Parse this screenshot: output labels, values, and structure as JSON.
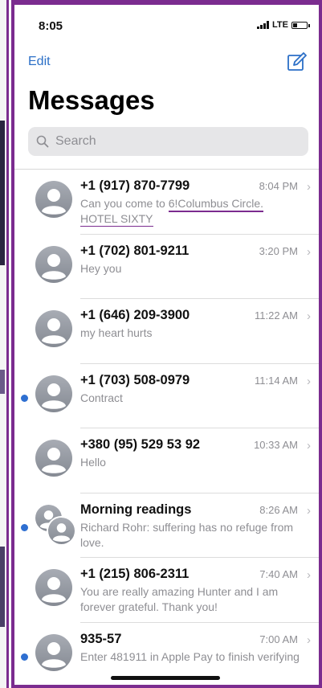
{
  "status_bar": {
    "time": "8:05",
    "network": "LTE",
    "battery_level": 0.3
  },
  "nav": {
    "edit_label": "Edit",
    "compose_icon": "compose-icon"
  },
  "page_title": "Messages",
  "search": {
    "placeholder": "Search",
    "icon": "magnifier-icon"
  },
  "colors": {
    "accent": "#2b6fc7",
    "unread_dot": "#2e6fd1",
    "annotation": "#7b2c8f",
    "secondary_text": "#8e8e93"
  },
  "conversations": [
    {
      "name": "+1 (917) 870-7799",
      "time": "8:04 PM",
      "preview_parts": [
        "Can you come to ",
        "6!Columbus Circle.",
        "HOTEL SIXTY"
      ],
      "unread": false
    },
    {
      "name": "+1 (702) 801-9211",
      "time": "3:20 PM",
      "preview": "Hey you",
      "unread": false
    },
    {
      "name": "+1 (646) 209-3900",
      "time": "11:22 AM",
      "preview": "my heart hurts",
      "unread": false
    },
    {
      "name": "+1 (703) 508-0979",
      "time": "11:14 AM",
      "preview": "Contract",
      "unread": true
    },
    {
      "name": "+380 (95) 529 53 92",
      "time": "10:33 AM",
      "preview": "Hello",
      "unread": false
    },
    {
      "name": "Morning readings",
      "time": "8:26 AM",
      "preview": "Richard Rohr:  suffering has no refuge from love.",
      "unread": true,
      "group": true
    },
    {
      "name": "+1 (215) 806-2311",
      "time": "7:40 AM",
      "preview": "You are really amazing Hunter and I am forever grateful.  Thank you!",
      "unread": false
    },
    {
      "name": "935-57",
      "time": "7:00 AM",
      "preview": "Enter 481911 in Apple Pay to finish verifying",
      "unread": true
    }
  ]
}
